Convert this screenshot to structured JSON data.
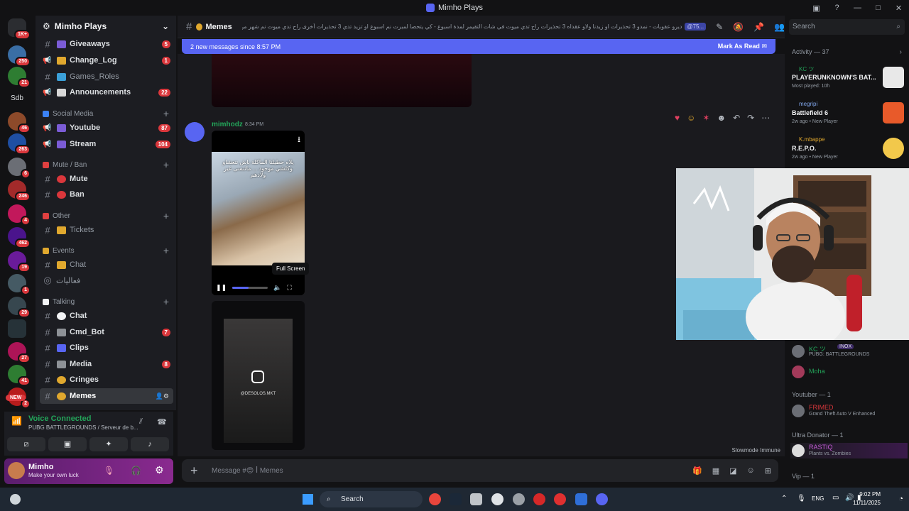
{
  "window": {
    "title": "Mimho Plays"
  },
  "server": {
    "name": "Mimho Plays",
    "rail_badges": [
      "1K+",
      "250",
      "21",
      "46",
      "263",
      "6",
      "246",
      "4",
      "462",
      "19",
      "1",
      "29",
      "27",
      "41",
      "2"
    ],
    "rail_label": "Sdb",
    "new_label": "NEW"
  },
  "channels": {
    "giveaways": {
      "label": "Giveaways",
      "badge": "5"
    },
    "change_log": {
      "label": "Change_Log",
      "badge": "1"
    },
    "games_roles": {
      "label": "Games_Roles"
    },
    "announcements": {
      "label": "Announcements",
      "badge": "22"
    },
    "cat_social": "Social Media",
    "youtube": {
      "label": "Youtube",
      "badge": "87"
    },
    "stream": {
      "label": "Stream",
      "badge": "104"
    },
    "cat_mute": "Mute / Ban",
    "mute": {
      "label": "Mute"
    },
    "ban": {
      "label": "Ban"
    },
    "cat_other": "Other",
    "tickets": {
      "label": "Tickets"
    },
    "cat_events": "Events",
    "events_chat": {
      "label": "Chat"
    },
    "voice_activities": {
      "label": "فعاليات"
    },
    "cat_talking": "Talking",
    "chat": {
      "label": "Chat"
    },
    "cmd_bot": {
      "label": "Cmd_Bot",
      "badge": "7"
    },
    "clips": {
      "label": "Clips"
    },
    "media": {
      "label": "Media",
      "badge": "8"
    },
    "cringes": {
      "label": "Cringes"
    },
    "memes": {
      "label": "Memes"
    }
  },
  "voice": {
    "status": "Voice Connected",
    "detail": "PUBG BATTLEGROUNDS / Serveur de b..."
  },
  "user": {
    "name": "Mimho",
    "status": "Make your own luck"
  },
  "header": {
    "channel": "Memes",
    "topic": "ديرو عقوبات - نمدو 3 تحذيرات او زيدنا ولاو عقداه 3 تحذيرات راح تدي ميوت في شات التقيمر لمدة اسبوع - كي يتحصا لمبرت نم اسبوع او تزيد تدي 3 تحذيرات أخرى راح تدي ميوت نم شهر من شات لمبير",
    "role_pill": "@75..."
  },
  "banner": {
    "text": "2 new messages since 8:57 PM",
    "action": "Mark As Read"
  },
  "message": {
    "author": "mimhodz",
    "time": "8:34 PM",
    "video_caption": "يلاه حطيلنا الماكلة باش نتعشاو وكلشي موجود ... ماتنسى غير ولادهم",
    "tooltip": "Full Screen",
    "progress": 0.45,
    "ig_handle": "@DESOLOS.MKT"
  },
  "composer": {
    "placeholder": "Message #😍 ꟾ Memes"
  },
  "search": {
    "placeholder": "Search"
  },
  "activity": {
    "title": "Activity — 37",
    "cards": [
      {
        "who": "KC ツ",
        "game": "PLAYERUNKNOWN'S BAT...",
        "meta": "Most played: 10h"
      },
      {
        "who": "megripi",
        "game": "Battlefield 6",
        "meta": "2w ago • New Player"
      },
      {
        "who": "K.mbappe",
        "game": "R.E.P.O.",
        "meta": "2w ago • New Player"
      }
    ]
  },
  "members": {
    "m1": {
      "name": "KC ツ",
      "tag": "INOX",
      "game": "PUBG: BATTLEGROUNDS"
    },
    "m2": {
      "name": "Moha"
    },
    "role_youtuber": "Youtuber — 1",
    "m3": {
      "name": "FRIMED",
      "game": "Grand Theft Auto V Enhanced"
    },
    "role_donator": "Ultra Donator — 1",
    "m4": {
      "name": "RASTIQ",
      "game": "Plants vs. Zombies"
    },
    "role_vip": "Vip — 1",
    "slowmode": "Slowmode Immune"
  },
  "taskbar": {
    "search": "Search",
    "lang": "ENG",
    "time": "9:02 PM",
    "date": "11/11/2025"
  },
  "colors": {
    "accent": "#5865f2",
    "online": "#23a55a",
    "badge": "#da373c"
  }
}
